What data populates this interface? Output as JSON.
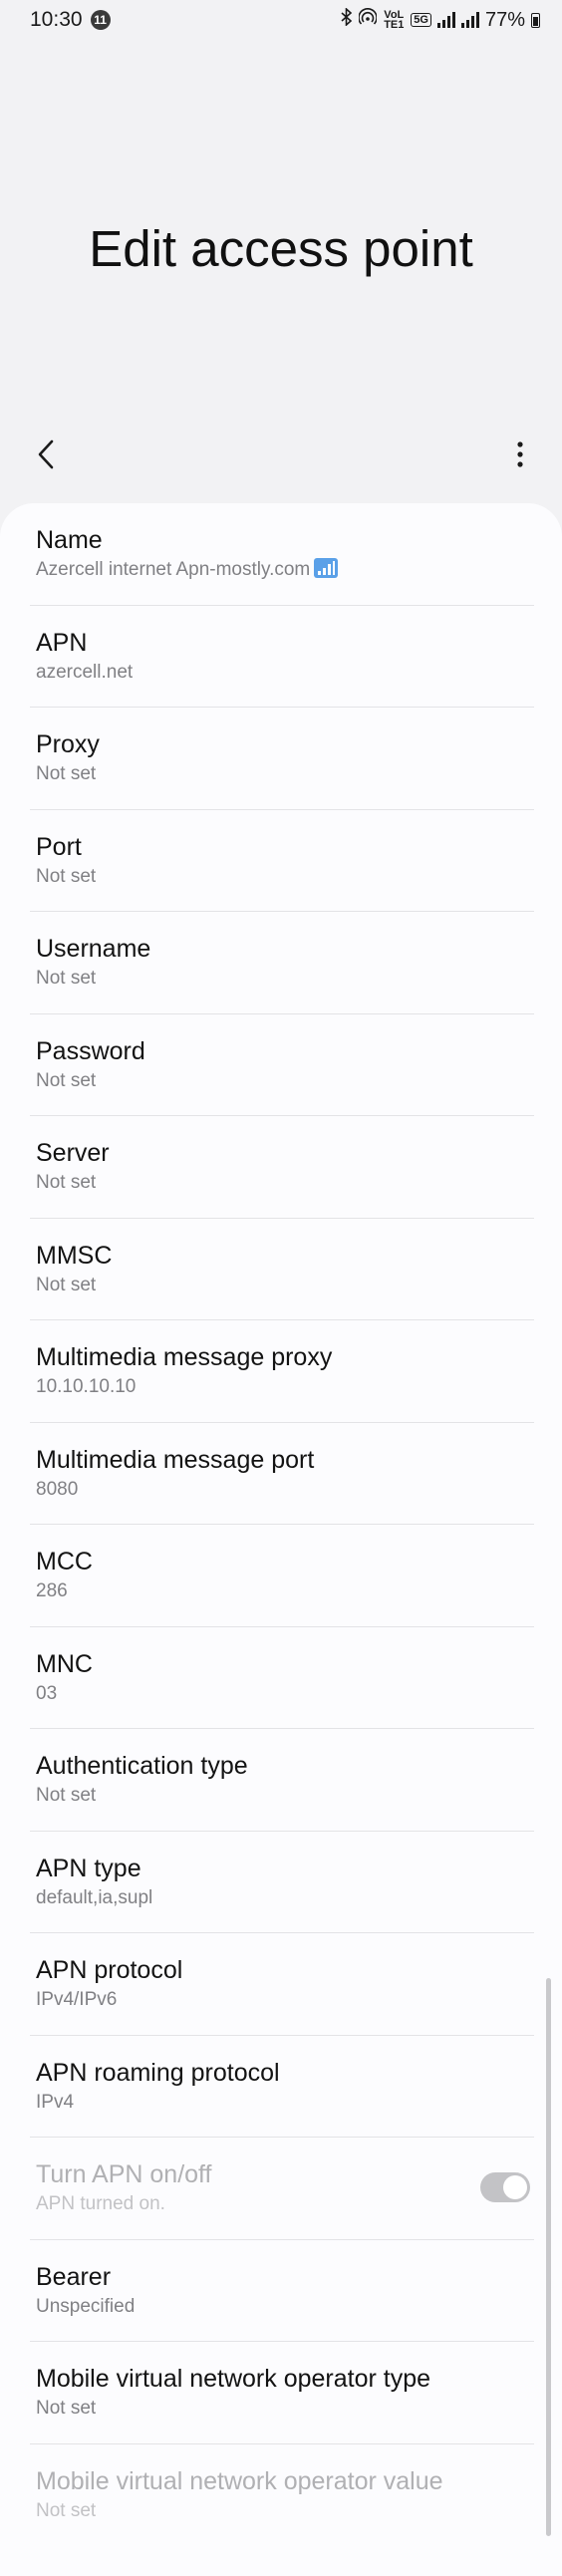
{
  "status_bar": {
    "time": "10:30",
    "notification_count": "11",
    "volte_label": "VoLTE1",
    "network": "5G",
    "battery": "77%"
  },
  "title": "Edit access point",
  "settings": [
    {
      "title": "Name",
      "value": "Azercell internet  Apn-mostly.com"
    },
    {
      "title": "APN",
      "value": "azercell.net"
    },
    {
      "title": "Proxy",
      "value": "Not set"
    },
    {
      "title": "Port",
      "value": "Not set"
    },
    {
      "title": "Username",
      "value": "Not set"
    },
    {
      "title": "Password",
      "value": "Not set"
    },
    {
      "title": "Server",
      "value": "Not set"
    },
    {
      "title": "MMSC",
      "value": "Not set"
    },
    {
      "title": "Multimedia message proxy",
      "value": "10.10.10.10"
    },
    {
      "title": "Multimedia message port",
      "value": "8080"
    },
    {
      "title": "MCC",
      "value": "286"
    },
    {
      "title": "MNC",
      "value": "03"
    },
    {
      "title": "Authentication type",
      "value": "Not set"
    },
    {
      "title": "APN type",
      "value": "default,ia,supl"
    },
    {
      "title": "APN protocol",
      "value": "IPv4/IPv6"
    },
    {
      "title": "APN roaming protocol",
      "value": "IPv4"
    },
    {
      "title": "Turn APN on/off",
      "value": "APN turned on."
    },
    {
      "title": "Bearer",
      "value": "Unspecified"
    },
    {
      "title": "Mobile virtual network operator type",
      "value": "Not set"
    },
    {
      "title": "Mobile virtual network operator value",
      "value": "Not set"
    }
  ],
  "icons": {
    "back": "chevron-left-icon",
    "more": "more-vertical-icon",
    "name_badge": "wifi-signal-icon"
  },
  "colors": {
    "background": "#f2f2f4",
    "card": "#fcfcfe",
    "toggle_track": "#c3c3c6",
    "divider": "#e3e3e6"
  }
}
